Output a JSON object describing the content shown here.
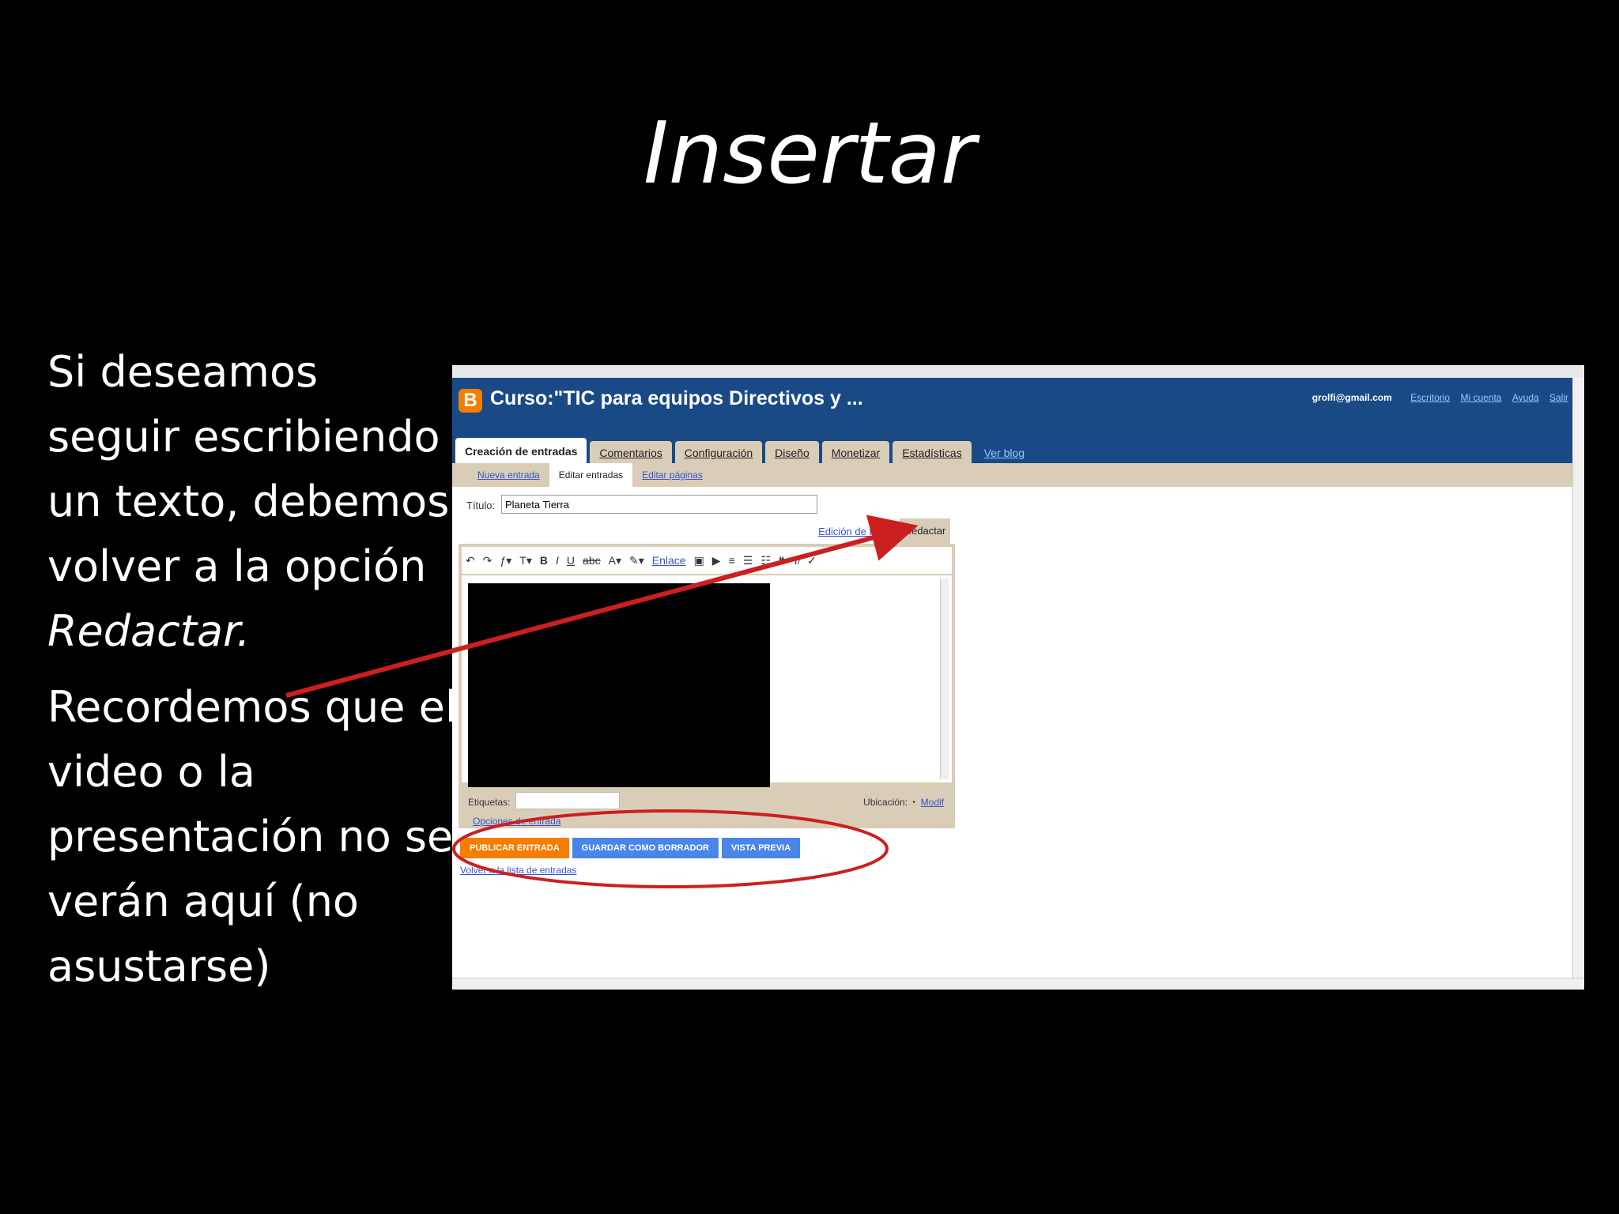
{
  "slide": {
    "title": "Insertar",
    "para1_text": "Si deseamos seguir escribiendo un texto, debemos volver a la opción ",
    "para1_emph": "Redactar.",
    "para2_text": "Recordemos que el video o la presentación no se verán aquí (no asustarse)"
  },
  "blogger": {
    "logo": "B",
    "blog_title": "Curso:\"TIC para equipos Directivos y ...",
    "user_email": "grolfi@gmail.com",
    "user_links": [
      "Escritorio",
      "Mi cuenta",
      "Ayuda",
      "Salir"
    ],
    "tabs": [
      {
        "label": "Creación de entradas",
        "active": true
      },
      {
        "label": "Comentarios"
      },
      {
        "label": "Configuración"
      },
      {
        "label": "Diseño"
      },
      {
        "label": "Monetizar"
      },
      {
        "label": "Estadísticas"
      }
    ],
    "view_blog": "Ver blog",
    "subtabs": [
      "Nueva entrada",
      "Editar entradas",
      "Editar páginas"
    ],
    "title_label": "Título:",
    "title_value": "Planeta Tierra",
    "mode_html": "Edición de HTML",
    "mode_compose": "Redactar",
    "toolbar_link": "Enlace",
    "labels_label": "Etiquetas:",
    "location_label": "Ubicación:",
    "location_link": "Modif",
    "post_options": "Opciones de entrada",
    "buttons": {
      "publish": "PUBLICAR ENTRADA",
      "save_draft": "GUARDAR COMO BORRADOR",
      "preview": "VISTA PREVIA"
    },
    "back_link": "Volver a la lista de entradas"
  },
  "colors": {
    "header_blue": "#1a4a86",
    "publish_orange": "#f57d00",
    "button_blue": "#4a86e8",
    "annotation_red": "#cc1f1f"
  },
  "icons": [
    "blogger-logo-icon",
    "undo-icon",
    "redo-icon",
    "font-icon",
    "font-size-icon",
    "bold-icon",
    "italic-icon",
    "underline-icon",
    "strike-icon",
    "text-color-icon",
    "highlight-icon",
    "image-icon",
    "video-icon",
    "align-icon",
    "ordered-list-icon",
    "unordered-list-icon",
    "quote-icon",
    "clear-format-icon",
    "spellcheck-icon",
    "location-icon"
  ]
}
